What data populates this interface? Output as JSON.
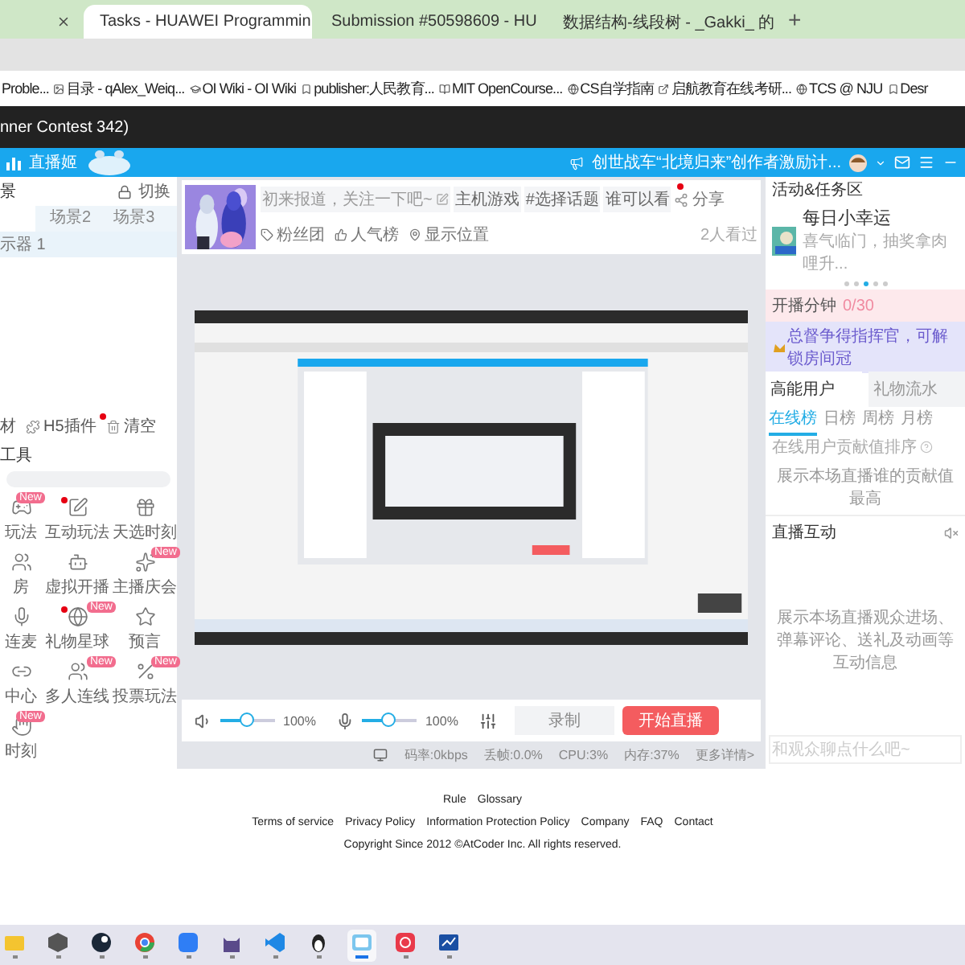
{
  "browser": {
    "tabs": [
      {
        "selected": false
      },
      {
        "title": "Tasks - HUAWEI Programmin",
        "selected": true
      },
      {
        "title": "Submission #50598609 - HU",
        "selected": false
      },
      {
        "title": "数据结构-线段树 - _Gakki_ 的",
        "selected": false
      }
    ],
    "new_tab": "+",
    "bookmarks": [
      "Proble...",
      "目录 - qAlex_Weiq...",
      "OI Wiki - OI Wiki",
      "publisher:人民教育...",
      "MIT OpenCourse...",
      "CS自学指南",
      "启航教育在线考研...",
      "TCS @ NJU",
      "Desr"
    ]
  },
  "page_title": "nner Contest 342)",
  "app": {
    "brand": "直播姬",
    "notice": "创世战车“北境归来”创作者激励计...",
    "left": {
      "title": "景",
      "switch": "切换",
      "scenes": [
        {
          "selected": true
        },
        {
          "label": "场景2",
          "selected": false
        },
        {
          "label": "场景3",
          "selected": false
        }
      ],
      "source": "示器 1",
      "toolbar": [
        {
          "label": "材",
          "dot": false
        },
        {
          "label": "H5插件",
          "dot": true
        },
        {
          "label": "清空",
          "dot": false
        }
      ],
      "tools_title": "工具",
      "tools": [
        {
          "label": "玩法",
          "badge": "New",
          "dot": false
        },
        {
          "label": "互动玩法",
          "dot": true
        },
        {
          "label": "天选时刻",
          "dot": false
        },
        {
          "label": "房",
          "dot": false
        },
        {
          "label": "虚拟开播",
          "dot": false
        },
        {
          "label": "主播庆会",
          "badge": "New",
          "dot": false
        },
        {
          "label": "连麦",
          "dot": false
        },
        {
          "label": "礼物星球",
          "badge": "New",
          "dot": true
        },
        {
          "label": "预言",
          "dot": false
        },
        {
          "label": "中心",
          "dot": false
        },
        {
          "label": "多人连线",
          "badge": "New",
          "dot": false
        },
        {
          "label": "投票玩法",
          "badge": "New",
          "dot": false
        },
        {
          "label": "时刻",
          "badge": "New",
          "dot": false
        }
      ]
    },
    "center": {
      "title": "初来报道，关注一下吧~",
      "chips": [
        {
          "label": "主机游戏",
          "dot": false
        },
        {
          "label": "#选择话题",
          "dot": false
        },
        {
          "label": "谁可以看",
          "dot": true
        }
      ],
      "share": "分享",
      "links": [
        "粉丝团",
        "人气榜",
        "显示位置"
      ],
      "views": "2人看过",
      "speaker": {
        "level": 0.5,
        "reading": "100%"
      },
      "mic": {
        "level": 0.5,
        "reading": "100%"
      },
      "record": "录制",
      "start": "开始直播",
      "stats": [
        "码率:0kbps",
        "丢帧:0.0%",
        "CPU:3%",
        "内存:37%"
      ],
      "details": "更多详情>"
    },
    "right": {
      "activity_title": "活动&任务区",
      "event": {
        "title": "每日小幸运",
        "subtitle": "喜气临门，抽奖拿肉哩升...",
        "dots": [
          {
            "selected": false
          },
          {
            "selected": false
          },
          {
            "selected": true
          },
          {
            "selected": false
          },
          {
            "selected": false
          }
        ]
      },
      "timer": {
        "label": "开播分钟",
        "value": "0/30"
      },
      "promo": "总督争得指挥官，可解锁房间冠",
      "user_tabs": [
        {
          "label": "高能用户",
          "selected": true
        },
        {
          "label": "礼物流水",
          "selected": false
        }
      ],
      "rank_tabs": [
        {
          "label": "在线榜",
          "selected": true
        },
        {
          "label": "日榜",
          "selected": false
        },
        {
          "label": "周榜",
          "selected": false
        },
        {
          "label": "月榜",
          "selected": false
        }
      ],
      "rank_hint": "在线用户贡献值排序",
      "rank_empty": "展示本场直播谁的贡献值最高",
      "interact_title": "直播互动",
      "interact_empty": "展示本场直播观众进场、弹幕评论、送礼及动画等互动信息",
      "chat_placeholder": "和观众聊点什么吧~"
    }
  },
  "footer": {
    "links_top": [
      "Rule",
      "Glossary"
    ],
    "links": [
      "Terms of service",
      "Privacy Policy",
      "Information Protection Policy",
      "Company",
      "FAQ",
      "Contact"
    ],
    "copyright": "Copyright Since 2012 ©AtCoder Inc. All rights reserved."
  },
  "taskbar": [
    {
      "kind": "folder",
      "selected": false
    },
    {
      "kind": "prism",
      "selected": false
    },
    {
      "kind": "steam",
      "selected": false
    },
    {
      "kind": "chrome",
      "selected": false
    },
    {
      "kind": "wave",
      "selected": false
    },
    {
      "kind": "cat",
      "selected": false
    },
    {
      "kind": "code",
      "selected": false
    },
    {
      "kind": "bird",
      "selected": false
    },
    {
      "kind": "live",
      "selected": true
    },
    {
      "kind": "swirl",
      "selected": false
    },
    {
      "kind": "board",
      "selected": false
    }
  ]
}
